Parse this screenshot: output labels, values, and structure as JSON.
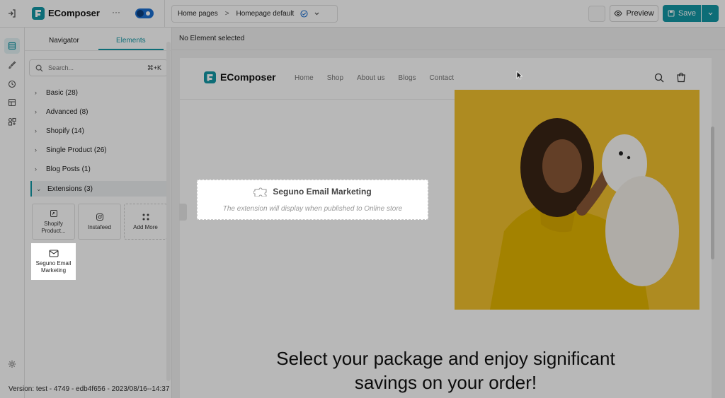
{
  "app": {
    "brand": "EComposer",
    "more_glyph": "···"
  },
  "topbar": {
    "breadcrumb_page": "Home pages",
    "breadcrumb_sep": ">",
    "breadcrumb_current": "Homepage default",
    "preview_label": "Preview",
    "save_label": "Save"
  },
  "panel": {
    "tabs": [
      {
        "label": "Navigator"
      },
      {
        "label": "Elements"
      }
    ],
    "active_tab": "Elements",
    "search": {
      "placeholder": "Search...",
      "shortcut": "⌘+K"
    },
    "categories": [
      {
        "label": "Basic (28)"
      },
      {
        "label": "Advanced (8)"
      },
      {
        "label": "Shopify (14)"
      },
      {
        "label": "Single Product (26)"
      },
      {
        "label": "Blog Posts (1)"
      },
      {
        "label": "Extensions (3)"
      }
    ],
    "expanded_category": "Extensions (3)",
    "tiles": [
      {
        "line1": "Shopify",
        "line2": "Product..."
      },
      {
        "line1": "Instafeed",
        "line2": ""
      },
      {
        "line1": "Add More",
        "line2": ""
      }
    ],
    "dragging_tile": {
      "line1": "Seguno Email",
      "line2": "Marketing"
    }
  },
  "status": {
    "no_selection": "No Element selected"
  },
  "preview": {
    "brand": "EComposer",
    "nav": [
      "Home",
      "Shop",
      "About us",
      "Blogs",
      "Contact"
    ],
    "extension": {
      "title": "Seguno Email Marketing",
      "note": "The extension will display when published to Online store"
    },
    "headline_1": "Select your package and enjoy significant",
    "headline_2": "savings on your order!"
  },
  "footer": {
    "version": "Version: test - 4749 - edb4f656 - 2023/08/16--14:37"
  },
  "colors": {
    "accent": "#1297a6",
    "toggle": "#1b6fd1",
    "brand_logo": "#1297a6",
    "hero_bg": "#f2c12e"
  }
}
